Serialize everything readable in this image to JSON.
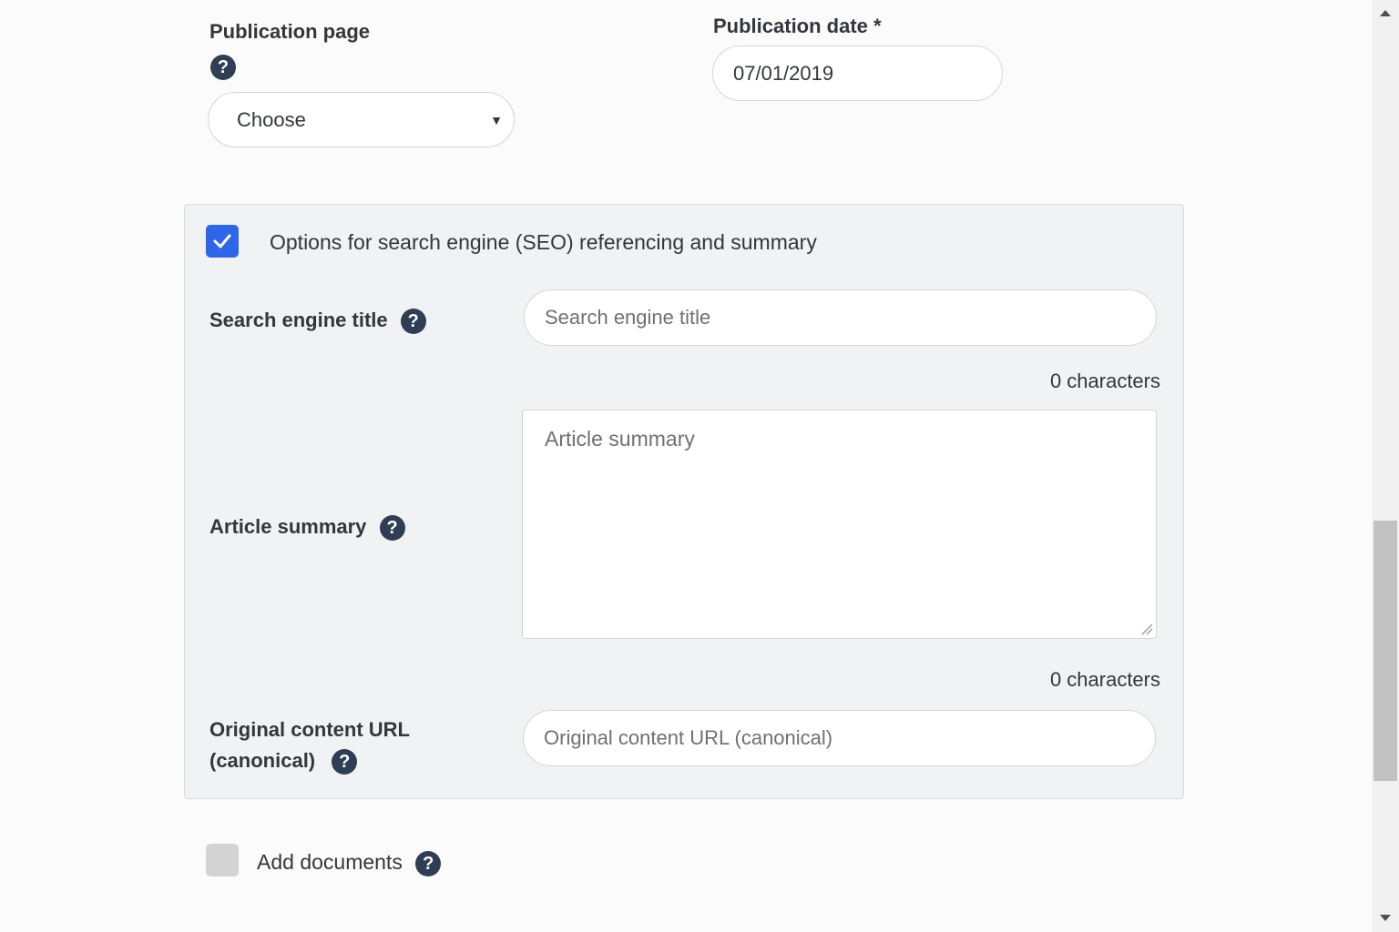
{
  "publication_page": {
    "label": "Publication page",
    "select_value": "Choose"
  },
  "publication_date": {
    "label": "Publication date *",
    "value": "07/01/2019"
  },
  "seo": {
    "checkbox_checked": true,
    "checkbox_label": "Options for search engine (SEO) referencing and summary",
    "search_title": {
      "label": "Search engine title",
      "placeholder": "Search engine title",
      "counter": "0 characters"
    },
    "summary": {
      "label": "Article summary",
      "placeholder": "Article summary",
      "counter": "0 characters"
    },
    "canonical": {
      "label_line1": "Original content URL",
      "label_line2": "(canonical)",
      "placeholder": "Original content URL (canonical)"
    }
  },
  "documents": {
    "checkbox_checked": false,
    "label": "Add documents"
  },
  "help_glyph": "?",
  "colors": {
    "accent": "#2f66e8",
    "help_icon": "#2f3d55",
    "panel_bg": "#f1f2f4"
  }
}
